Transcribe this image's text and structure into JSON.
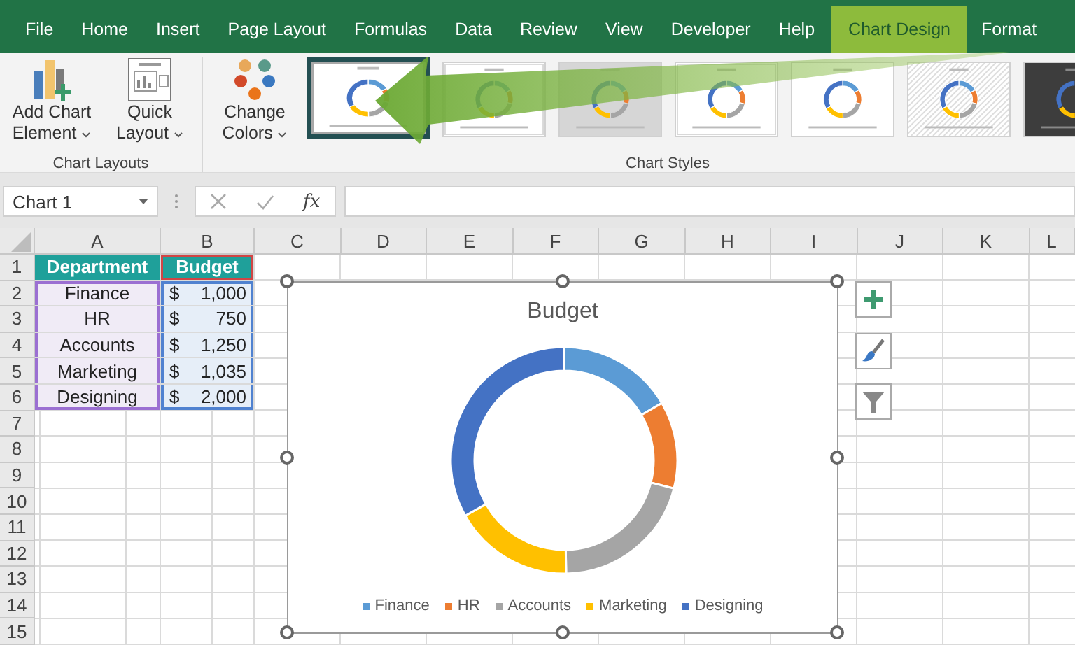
{
  "menu_tabs": [
    {
      "label": "File",
      "selected": false
    },
    {
      "label": "Home",
      "selected": false
    },
    {
      "label": "Insert",
      "selected": false
    },
    {
      "label": "Page Layout",
      "selected": false
    },
    {
      "label": "Formulas",
      "selected": false
    },
    {
      "label": "Data",
      "selected": false
    },
    {
      "label": "Review",
      "selected": false
    },
    {
      "label": "View",
      "selected": false
    },
    {
      "label": "Developer",
      "selected": false
    },
    {
      "label": "Help",
      "selected": false
    },
    {
      "label": "Chart Design",
      "selected": true
    },
    {
      "label": "Format",
      "selected": false
    }
  ],
  "ribbon": {
    "groups": [
      {
        "label": "Chart Layouts",
        "buttons": [
          {
            "kind": "add-element",
            "label": "Add Chart Element"
          },
          {
            "kind": "quick-layout",
            "label": "Quick Layout"
          }
        ]
      },
      {
        "label": "Chart Styles",
        "buttons": [
          {
            "kind": "change-colors",
            "label": "Change Colors"
          }
        ],
        "gallery": [
          {
            "kind": "plain",
            "selected": true
          },
          {
            "kind": "outline",
            "selected": false
          },
          {
            "kind": "shaded",
            "selected": false
          },
          {
            "kind": "outline",
            "selected": false
          },
          {
            "kind": "plain",
            "selected": false
          },
          {
            "kind": "hatched",
            "selected": false
          },
          {
            "kind": "dark",
            "selected": false
          }
        ]
      }
    ]
  },
  "formula_bar": {
    "name_box": "Chart 1",
    "function_label": "fx"
  },
  "sheet": {
    "columns": [
      "A",
      "B",
      "C",
      "D",
      "E",
      "F",
      "G",
      "H",
      "I",
      "J",
      "K",
      "L"
    ],
    "rows": [
      "1",
      "2",
      "3",
      "4",
      "5",
      "6",
      "7",
      "8",
      "9",
      "10",
      "11",
      "12",
      "13",
      "14",
      "15"
    ],
    "table": {
      "headers": [
        "Department",
        "Budget"
      ],
      "rows": [
        {
          "department": "Finance",
          "currency": "$",
          "amount": "1,000"
        },
        {
          "department": "HR",
          "currency": "$",
          "amount": "750"
        },
        {
          "department": "Accounts",
          "currency": "$",
          "amount": "1,250"
        },
        {
          "department": "Marketing",
          "currency": "$",
          "amount": "1,035"
        },
        {
          "department": "Designing",
          "currency": "$",
          "amount": "2,000"
        }
      ]
    }
  },
  "chart": {
    "chart_data": {
      "type": "donut",
      "title": "Budget",
      "categories": [
        "Finance",
        "HR",
        "Accounts",
        "Marketing",
        "Designing"
      ],
      "colors": [
        "#5b9bd5",
        "#ed7d31",
        "#a5a5a5",
        "#ffc000",
        "#4472c4"
      ],
      "legend": "bottom",
      "series": [
        {
          "values": [
            16.57,
            12.43,
            20.71,
            17.15,
            33.14
          ]
        }
      ]
    },
    "side_buttons": [
      {
        "kind": "add"
      },
      {
        "kind": "style"
      },
      {
        "kind": "filter"
      }
    ]
  }
}
